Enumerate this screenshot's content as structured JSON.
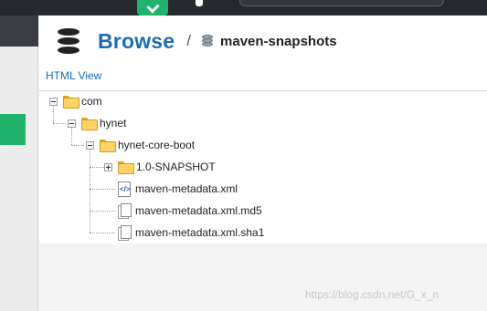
{
  "header": {
    "title": "Browse",
    "separator": "/",
    "repository": "maven-snapshots"
  },
  "view_link": "HTML View",
  "tree": {
    "nodes": [
      {
        "label": "com",
        "type": "folder",
        "state": "expanded"
      },
      {
        "label": "hynet",
        "type": "folder",
        "state": "expanded"
      },
      {
        "label": "hynet-core-boot",
        "type": "folder",
        "state": "expanded"
      },
      {
        "label": "1.0-SNAPSHOT",
        "type": "folder",
        "state": "collapsed"
      },
      {
        "label": "maven-metadata.xml",
        "type": "xml-file"
      },
      {
        "label": "maven-metadata.xml.md5",
        "type": "file"
      },
      {
        "label": "maven-metadata.xml.sha1",
        "type": "file"
      }
    ]
  },
  "watermark": "https://blog.csdn.net/G_x_n",
  "colors": {
    "accent": "#1fb36b",
    "link": "#1d6bb8",
    "topbar": "#262a2e",
    "folder": "#ffd365"
  }
}
